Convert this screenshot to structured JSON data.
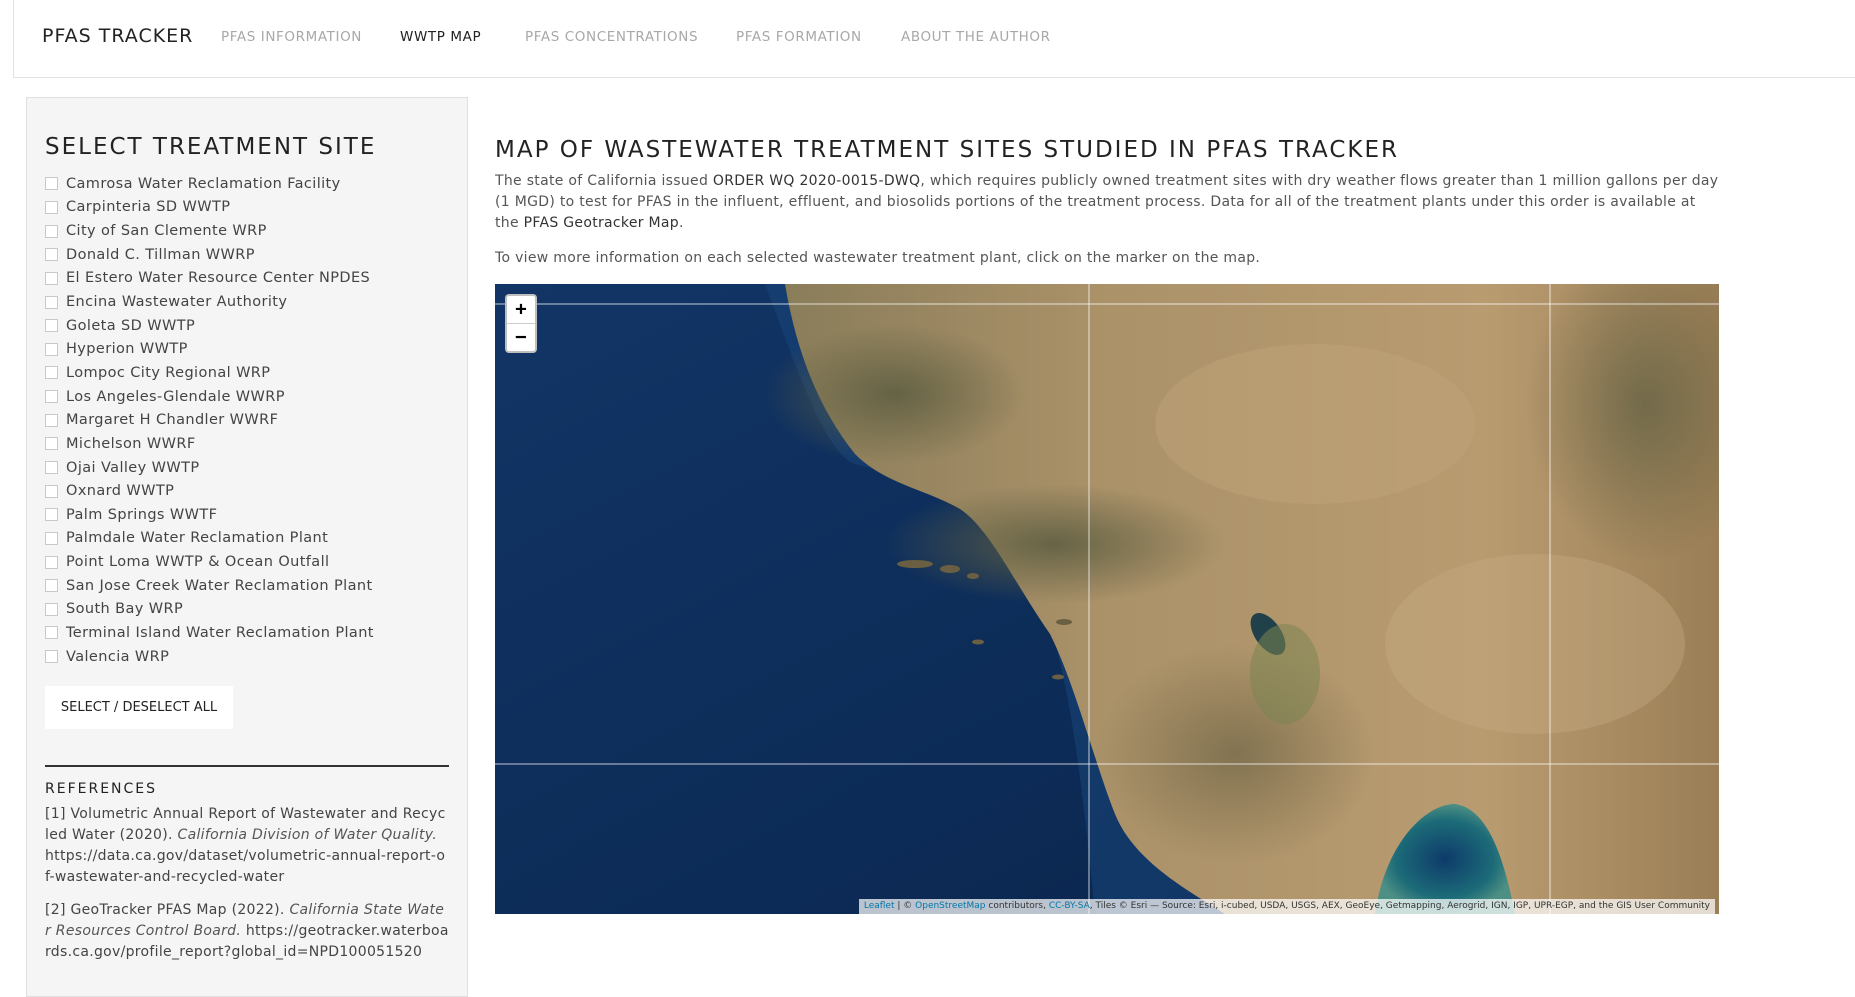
{
  "navbar": {
    "brand": "PFAS TRACKER",
    "links": [
      {
        "label": "PFAS INFORMATION"
      },
      {
        "label": "WWTP MAP"
      },
      {
        "label": "PFAS CONCENTRATIONS"
      },
      {
        "label": "PFAS FORMATION"
      },
      {
        "label": "ABOUT THE AUTHOR"
      }
    ],
    "active_link": "WWTP MAP"
  },
  "sidebar": {
    "title": "SELECT TREATMENT SITE",
    "sites": [
      "Camrosa Water Reclamation Facility",
      "Carpinteria SD WWTP",
      "City of San Clemente WRP",
      "Donald C. Tillman WWRP",
      "El Estero Water Resource Center NPDES",
      "Encina Wastewater Authority",
      "Goleta SD WWTP",
      "Hyperion WWTP",
      "Lompoc City Regional WRP",
      "Los Angeles-Glendale WWRP",
      "Margaret H Chandler WWRF",
      "Michelson WWRF",
      "Ojai Valley WWTP",
      "Oxnard WWTP",
      "Palm Springs WWTF",
      "Palmdale Water Reclamation Plant",
      "Point Loma WWTP & Ocean Outfall",
      "San Jose Creek Water Reclamation Plant",
      "South Bay WRP",
      "Terminal Island Water Reclamation Plant",
      "Valencia WRP"
    ],
    "select_all_label": "SELECT / DESELECT ALL",
    "references_title": "REFERENCES",
    "references": [
      {
        "prefix": "[1] Volumetric Annual Report of Wastewater and Recycled Water (2020). ",
        "source": "California Division of Water Quality.",
        "url": " https://data.ca.gov/dataset/volumetric-annual-report-of-wastewater-and-recycled-water"
      },
      {
        "prefix": "[2] GeoTracker PFAS Map (2022). ",
        "source": "California State Water Resources Control Board.",
        "url": " https://geotracker.waterboards.ca.gov/profile_report?global_id=NPD100051520"
      }
    ]
  },
  "main": {
    "title": "MAP OF WASTEWATER TREATMENT SITES STUDIED IN PFAS TRACKER",
    "intro_part1": "The state of California issued ",
    "order_id": "ORDER WQ 2020-0015-DWQ",
    "intro_part2": ", which requires publicly owned treatment sites with dry weather flows greater than 1 million gallons per day (1 MGD) to test for PFAS in the influent, effluent, and biosolids portions of the treatment process. Data for all of the treatment plants under this order is available at the ",
    "geotracker_link": "PFAS Geotracker Map",
    "intro_part3": ".",
    "instructions": "To view more information on each selected wastewater treatment plant, click on the marker on the map."
  },
  "map": {
    "zoom_in": "+",
    "zoom_out": "−",
    "attr_leaflet": "Leaflet",
    "attr_sep1": " | © ",
    "attr_osm": "OpenStreetMap",
    "attr_contrib": " contributors, ",
    "attr_cc": "CC-BY-SA",
    "attr_tiles": ", Tiles © Esri — Source: Esri, i-cubed, USDA, USGS, AEX, GeoEye, Getmapping, Aerogrid, IGN, IGP, UPR-EGP, and the GIS User Community",
    "colors": {
      "ocean_deep": "#0b2550",
      "ocean_shelf": "#1a4a7e",
      "land_desert": "#b99a72",
      "land_mountain": "#6f6a4c",
      "salton_sea": "#1f6f7a"
    }
  }
}
